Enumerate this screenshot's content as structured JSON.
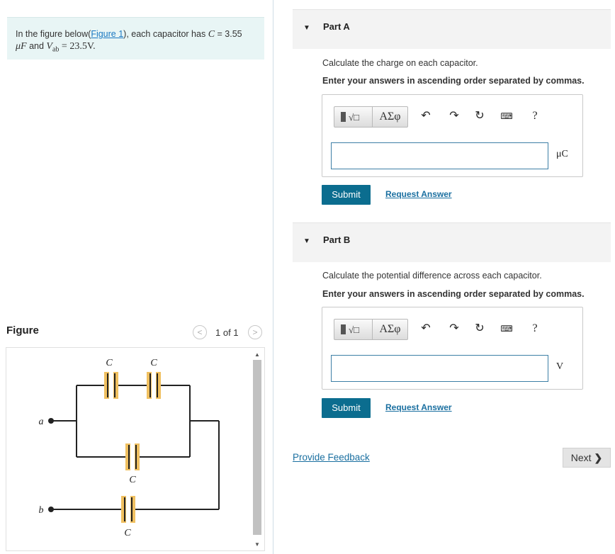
{
  "problem": {
    "prefix": "In the figure below(",
    "figure_link": "Figure 1",
    "middle": "), each capacitor has ",
    "c_symbol": "C",
    "c_value": " = 3.55",
    "units_line_1": "μF",
    "and_text": " and ",
    "v_symbol": "V",
    "v_sub": "ab",
    "v_value": " = 23.5V."
  },
  "figure": {
    "label": "Figure",
    "page": "1 of 1",
    "prev": "<",
    "next": ">",
    "node_a": "a",
    "node_b": "b",
    "cap_label": "C"
  },
  "partA": {
    "title": "Part A",
    "instruction": "Calculate the charge on each capacitor.",
    "emphasis": "Enter your answers in ascending order separated by commas.",
    "unit": "μC",
    "submit": "Submit",
    "request": "Request Answer",
    "greek": "ΑΣφ",
    "help": "?"
  },
  "partB": {
    "title": "Part B",
    "instruction": "Calculate the potential difference across each capacitor.",
    "emphasis": "Enter your answers in ascending order separated by commas.",
    "unit": "V",
    "submit": "Submit",
    "request": "Request Answer",
    "greek": "ΑΣφ",
    "help": "?"
  },
  "footer": {
    "feedback": "Provide Feedback",
    "next": "Next"
  },
  "icons": [
    "templates-icon",
    "undo-icon",
    "redo-icon",
    "reset-icon",
    "keyboard-icon",
    "help-icon",
    "collapse-triangle-icon"
  ],
  "colors": {
    "accent": "#0b6d8f",
    "link": "#1a6fa0",
    "capacitor": "#f0c060",
    "problem_bg": "#e8f5f5"
  }
}
